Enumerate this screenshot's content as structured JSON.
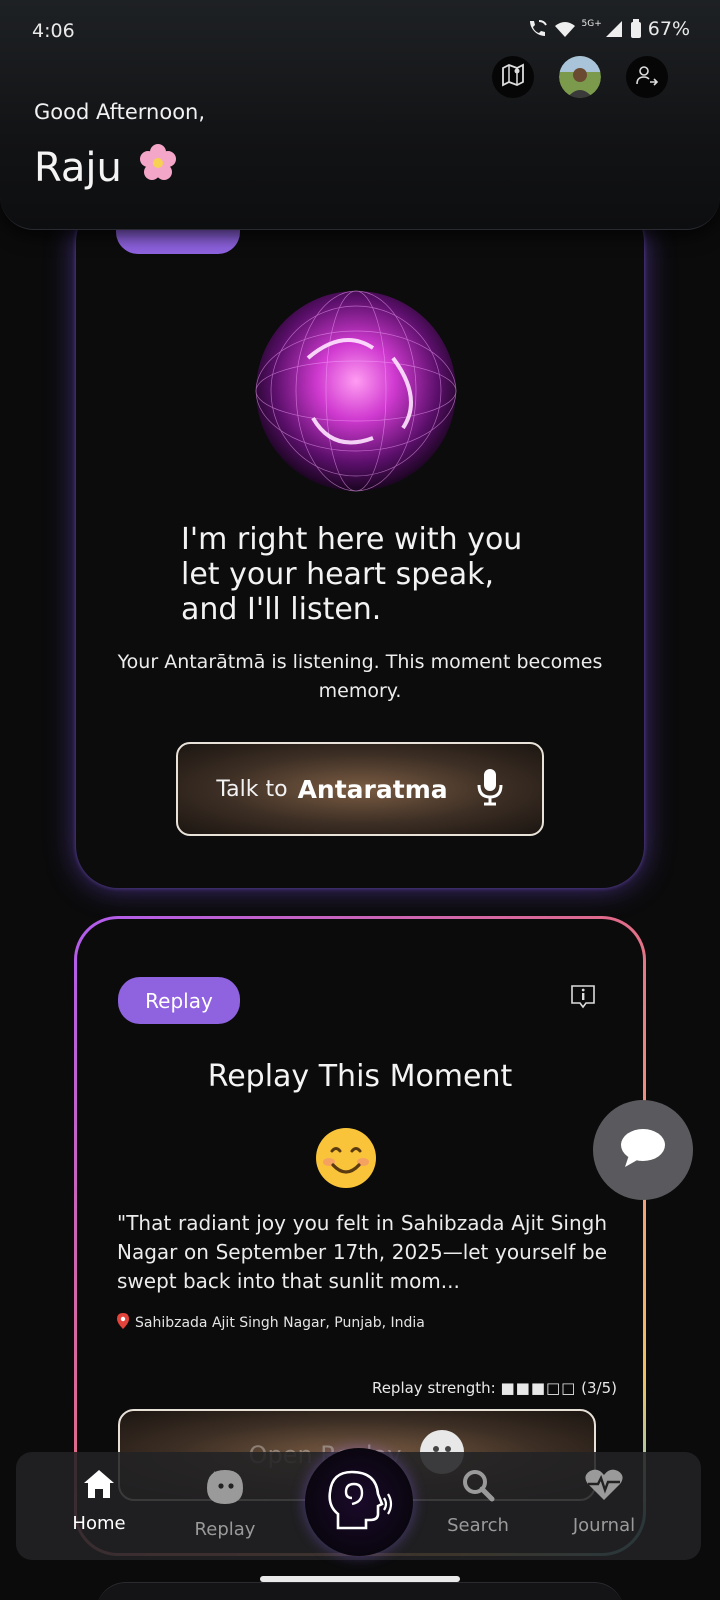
{
  "status_bar": {
    "time": "4:06",
    "battery": "67%",
    "network": "5G+"
  },
  "header": {
    "greeting": "Good Afternoon,",
    "user_name": "Raju"
  },
  "listen_card": {
    "tag_label": "",
    "heading_lines": [
      "I'm right here with you",
      "let your heart speak,",
      "and I'll listen."
    ],
    "subtitle": "Your Antarātmā is listening. This moment becomes memory.",
    "talk_button": {
      "prefix": "Talk to",
      "name": "Antaratma"
    }
  },
  "replay_card": {
    "tag_label": "Replay",
    "title": "Replay This Moment",
    "emoji": "smiling-face",
    "quote": "\"That radiant joy you felt in Sahibzada Ajit Singh Nagar on September 17th, 2025—let yourself be swept back into that sunlit mom...",
    "location": "Sahibzada Ajit Singh Nagar, Punjab, India",
    "strength_label": "Replay strength:",
    "strength_value": 3,
    "strength_max": 5,
    "strength_text": "(3/5)",
    "open_button_label": "Open Replay"
  },
  "nav": {
    "items": [
      {
        "label": "Home",
        "icon": "home-icon",
        "active": true
      },
      {
        "label": "Replay",
        "icon": "replay-face-icon",
        "active": false
      },
      {
        "label": "Search",
        "icon": "search-icon",
        "active": false
      },
      {
        "label": "Journal",
        "icon": "heart-pulse-icon",
        "active": false
      }
    ]
  },
  "colors": {
    "accent": "#8f63e0",
    "background": "#0b0b0c",
    "button_brown": "#7a5c43"
  }
}
